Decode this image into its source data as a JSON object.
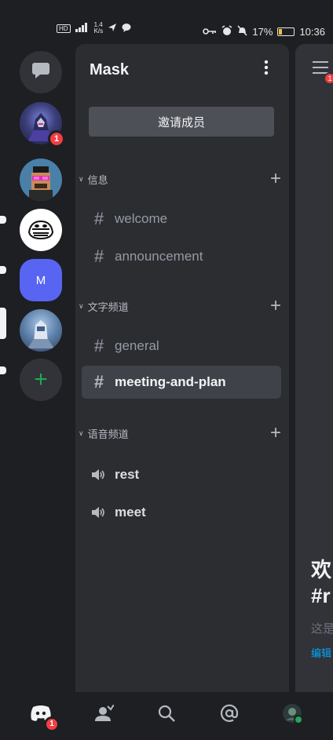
{
  "status_bar": {
    "left_icons": [
      "hd-icon",
      "signal-icon",
      "data-speed",
      "send-icon",
      "chat-bubble-icon"
    ],
    "data_speed": "1.4\nK/s",
    "battery_percent": "17%",
    "time": "10:36",
    "battery_level": 0.17
  },
  "servers": [
    {
      "name": "direct-messages",
      "icon": "chat-bubble-icon"
    },
    {
      "name": "robot-avatar-server",
      "badge": "1"
    },
    {
      "name": "pixel-avatar-server",
      "unread": true
    },
    {
      "name": "meme-server",
      "unread": true
    },
    {
      "name": "mask-server",
      "letter": "M",
      "active": true
    },
    {
      "name": "mech-avatar-server",
      "unread": true
    }
  ],
  "panel": {
    "server_title": "Mask",
    "invite_label": "邀请成员",
    "categories": [
      {
        "label": "信息",
        "channels": [
          {
            "label": "welcome",
            "type": "text"
          },
          {
            "label": "announcement",
            "type": "text"
          }
        ]
      },
      {
        "label": "文字频道",
        "channels": [
          {
            "label": "general",
            "type": "text"
          },
          {
            "label": "meeting-and-plan",
            "type": "text",
            "selected": true
          }
        ]
      },
      {
        "label": "语音频道",
        "channels": [
          {
            "label": "rest",
            "type": "voice"
          },
          {
            "label": "meet",
            "type": "voice"
          }
        ]
      }
    ]
  },
  "peek": {
    "badge": "1",
    "line1": "欢",
    "line2": "#r",
    "line3": "这是",
    "line4": "编辑"
  },
  "bottom_nav": {
    "home_badge": "1",
    "items": [
      "home-icon",
      "friends-icon",
      "search-icon",
      "mentions-icon",
      "profile-avatar"
    ]
  },
  "colors": {
    "accent": "#5865f2",
    "badge": "#f23f43",
    "online": "#23a55a",
    "link": "#00a8fc"
  }
}
